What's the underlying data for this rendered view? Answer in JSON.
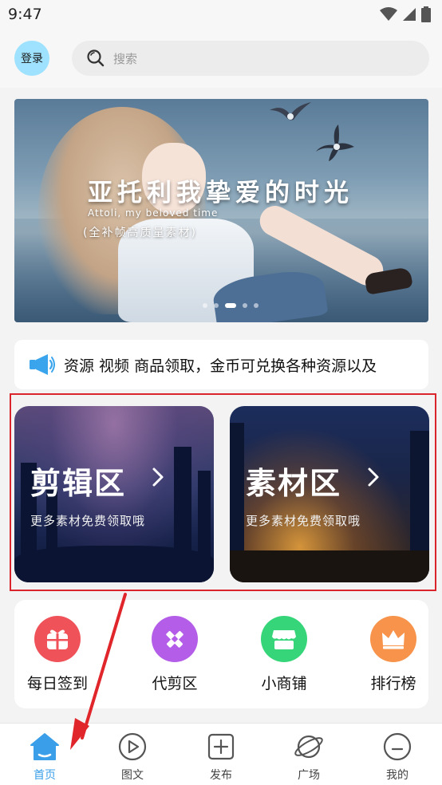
{
  "status_bar": {
    "time": "9:47"
  },
  "header": {
    "login_label": "登录",
    "search_placeholder": "搜索"
  },
  "banner": {
    "title": "亚托利我挚爱的时光",
    "subtitle": "Attoli, my beloved time",
    "caption": "(全补帧高质量素材)",
    "slide_count": 5,
    "active_slide": 3
  },
  "notice": {
    "text": "资源 视频 商品领取，金币可兑换各种资源以及"
  },
  "zones": [
    {
      "title": "剪辑区",
      "subtitle": "更多素材免费领取哦"
    },
    {
      "title": "素材区",
      "subtitle": "更多素材免费领取哦"
    }
  ],
  "quick_menu": [
    {
      "label": "每日签到",
      "icon": "gift-icon",
      "color": "#f0525a"
    },
    {
      "label": "代剪区",
      "icon": "pencil-ruler-icon",
      "color": "#b35de8"
    },
    {
      "label": "小商铺",
      "icon": "shop-icon",
      "color": "#37d57a"
    },
    {
      "label": "排行榜",
      "icon": "crown-icon",
      "color": "#f7934a"
    }
  ],
  "tabs": [
    {
      "label": "首页",
      "icon": "home-icon",
      "active": true
    },
    {
      "label": "图文",
      "icon": "play-circle-icon",
      "active": false
    },
    {
      "label": "发布",
      "icon": "plus-square-icon",
      "active": false
    },
    {
      "label": "广场",
      "icon": "planet-icon",
      "active": false
    },
    {
      "label": "我的",
      "icon": "user-icon",
      "active": false
    }
  ],
  "colors": {
    "accent": "#3a9fe8",
    "highlight": "#d9252b",
    "login_bg": "#9ee2ff"
  }
}
